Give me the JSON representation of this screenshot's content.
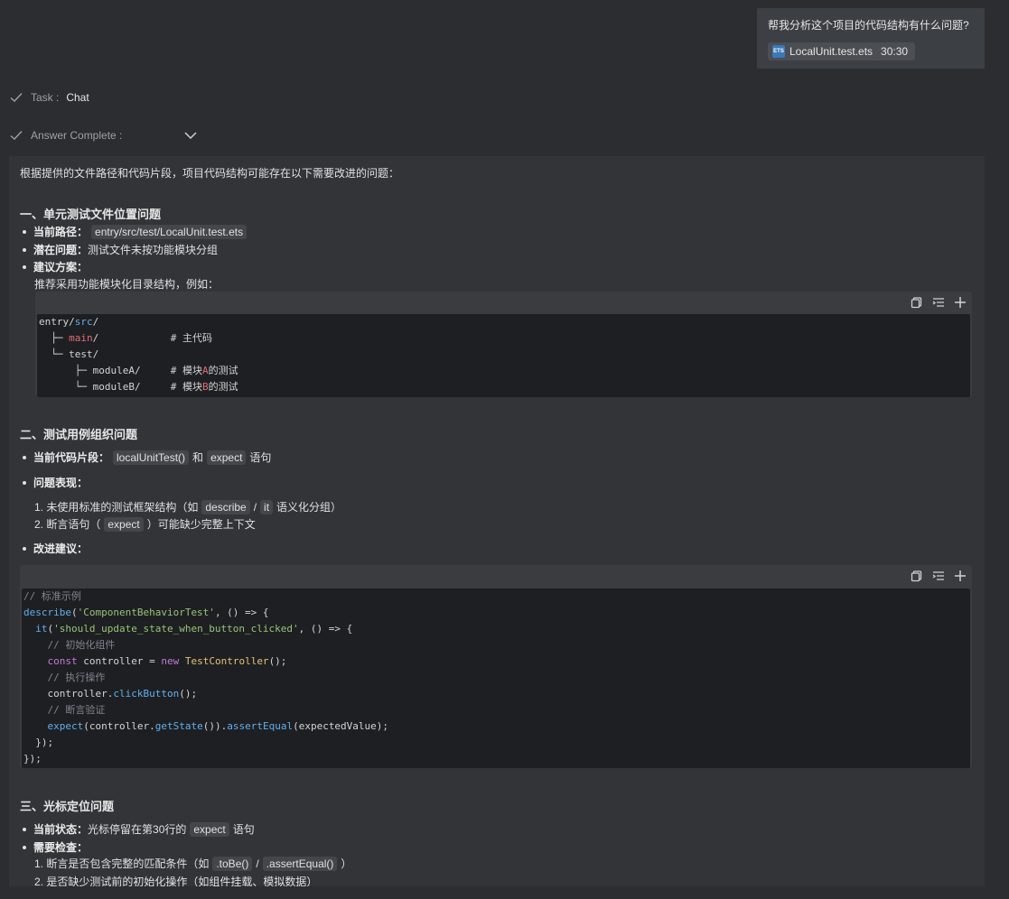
{
  "user_message": {
    "question": "帮我分析这个项目的代码结构有什么问题?",
    "file_name": "LocalUnit.test.ets",
    "file_line": "30:30",
    "file_icon": "ets-file-icon"
  },
  "status": {
    "task_key": "Task :",
    "task_value": "Chat",
    "answer_key": "Answer Complete :"
  },
  "answer": {
    "intro": "根据提供的文件路径和代码片段，项目代码结构可能存在以下需要改进的问题：",
    "section1": {
      "title": "一、单元测试文件位置问题",
      "b1_label": "当前路径：",
      "b1_code": "entry/src/test/LocalUnit.test.ets",
      "b2_label": "潜在问题：",
      "b2_text": "测试文件未按功能模块分组",
      "b3_label": "建议方案：",
      "b3_sub": "推荐采用功能模块化目录结构，例如："
    },
    "section2": {
      "title": "二、测试用例组织问题",
      "b1_label": "当前代码片段：",
      "b1_code1": "localUnitTest()",
      "b1_mid": "和",
      "b1_code2": "expect",
      "b1_tail": "语句",
      "b2_label": "问题表现：",
      "item1_pre": "1. 未使用标准的测试框架结构（如",
      "item1_code1": "describe",
      "item1_sep": "/",
      "item1_code2": "it",
      "item1_post": "语义化分组）",
      "item2_pre": "2. 断言语句（",
      "item2_code": "expect",
      "item2_post": "）可能缺少完整上下文",
      "b3_label": "改进建议："
    },
    "section3": {
      "title": "三、光标定位问题",
      "b1_label": "当前状态：",
      "b1_pre": "光标停留在第30行的",
      "b1_code": "expect",
      "b1_post": "语句",
      "b2_label": "需要检查：",
      "item1_pre": "1. 断言是否包含完整的匹配条件（如",
      "item1_code1": ".toBe()",
      "item1_sep": "/",
      "item1_code2": ".assertEqual()",
      "item1_post": "）",
      "item2": "2. 是否缺少测试前的初始化操作（如组件挂载、模拟数据）"
    }
  },
  "code_tree": {
    "l1_a": "entry/",
    "l1_b": "src",
    "l1_c": "/",
    "l2_pre": "  ├─ ",
    "l2_dir": "main",
    "l2_post": "/            # 主代码",
    "l3": "  └─ test/",
    "l4_pre": "      ├─ moduleA/     # 模块",
    "l4_hl": "A",
    "l4_post": "的测试",
    "l5_pre": "      └─ moduleB/     # 模块",
    "l5_hl": "B",
    "l5_post": "的测试"
  },
  "code_example": {
    "l1": "// 标准示例",
    "l2_fn": "describe",
    "l2_str": "'ComponentBehaviorTest'",
    "l2_post": ", () => {",
    "l3_fn": "it",
    "l3_str": "'should_update_state_when_button_clicked'",
    "l3_post": ", () => {",
    "l4": "// 初始化组件",
    "l5_kw": "const",
    "l5_mid": " controller = ",
    "l5_new": "new",
    "l5_cls": "TestController",
    "l5_post": "();",
    "l6": "// 执行操作",
    "l7_pre": "controller.",
    "l7_fn": "clickButton",
    "l7_post": "();",
    "l8": "// 断言验证",
    "l9_fn": "expect",
    "l9_mid": "(controller.",
    "l9_fn2": "getState",
    "l9_mid2": "()).",
    "l9_fn3": "assertEqual",
    "l9_post": "(expectedValue);",
    "l10": "  });",
    "l11": "});"
  },
  "toolbar": {
    "copy_icon": "copy-icon",
    "insert_icon": "insert-icon",
    "add_icon": "add-icon"
  }
}
